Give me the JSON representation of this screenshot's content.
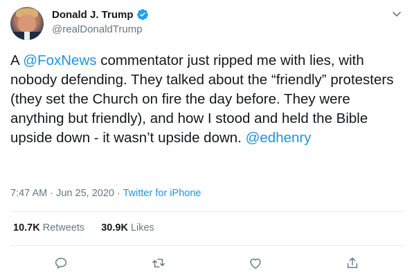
{
  "tweet": {
    "author": {
      "name": "Donald J. Trump",
      "handle": "@realDonaldTrump",
      "verified": true
    },
    "text_segments": [
      {
        "text": "A ",
        "type": "text"
      },
      {
        "text": "@FoxNews",
        "type": "mention"
      },
      {
        "text": " commentator just ripped me with lies, with nobody defending. They talked about the “friendly” protesters (they set the Church on fire the day before. They were anything but friendly), and how I stood and held the Bible upside down - it wasn’t upside down. ",
        "type": "text"
      },
      {
        "text": "@edhenry",
        "type": "mention"
      }
    ],
    "time": "7:47 AM",
    "date": "Jun 25, 2020",
    "separator": "·",
    "source": "Twitter for iPhone",
    "stats": {
      "retweets_count": "10.7K",
      "retweets_label": "Retweets",
      "likes_count": "30.9K",
      "likes_label": "Likes"
    }
  },
  "icons": {
    "verified": "verified-badge-icon",
    "menu": "chevron-down-icon",
    "reply": "reply-icon",
    "retweet": "retweet-icon",
    "like": "heart-icon",
    "share": "share-icon"
  },
  "colors": {
    "link": "#1b95e0",
    "secondary_text": "#657786",
    "primary_text": "#14171a",
    "divider": "#e6ecf0",
    "verified_badge": "#1da1f2"
  }
}
